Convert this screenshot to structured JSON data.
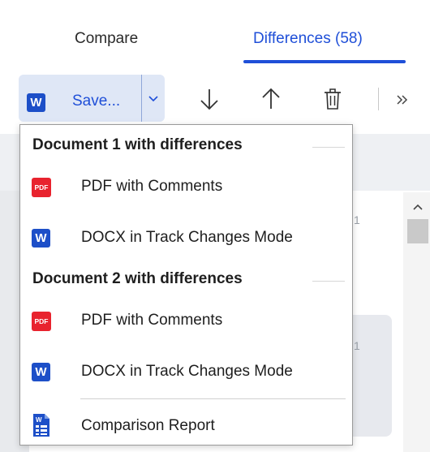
{
  "tabs": [
    {
      "label": "Compare",
      "active": false
    },
    {
      "label": "Differences (58)",
      "active": true
    }
  ],
  "toolbar": {
    "save_label": "Save...",
    "save_icon": "word-icon",
    "buttons": [
      "next-difference-icon",
      "previous-difference-icon",
      "delete-icon",
      "more-icon"
    ]
  },
  "background": {
    "fragment_1": "1",
    "fragment_2": "1"
  },
  "menu": {
    "section1_header": "Document 1 with differences",
    "section1_items": [
      {
        "label": "PDF with Comments",
        "icon": "pdf-icon",
        "icon_text": "PDF"
      },
      {
        "label": "DOCX in Track Changes Mode",
        "icon": "word-icon",
        "icon_text": "W"
      }
    ],
    "section2_header": "Document 2 with differences",
    "section2_items": [
      {
        "label": "PDF with Comments",
        "icon": "pdf-icon",
        "icon_text": "PDF"
      },
      {
        "label": "DOCX in Track Changes Mode",
        "icon": "word-icon",
        "icon_text": "W"
      }
    ],
    "report_item": {
      "label": "Comparison Report",
      "icon": "comparison-report-icon"
    }
  },
  "colors": {
    "accent": "#1f4fd8",
    "word_icon": "#1d4fc8",
    "pdf_icon": "#e8232e",
    "save_button_bg": "#dfe7f6"
  }
}
